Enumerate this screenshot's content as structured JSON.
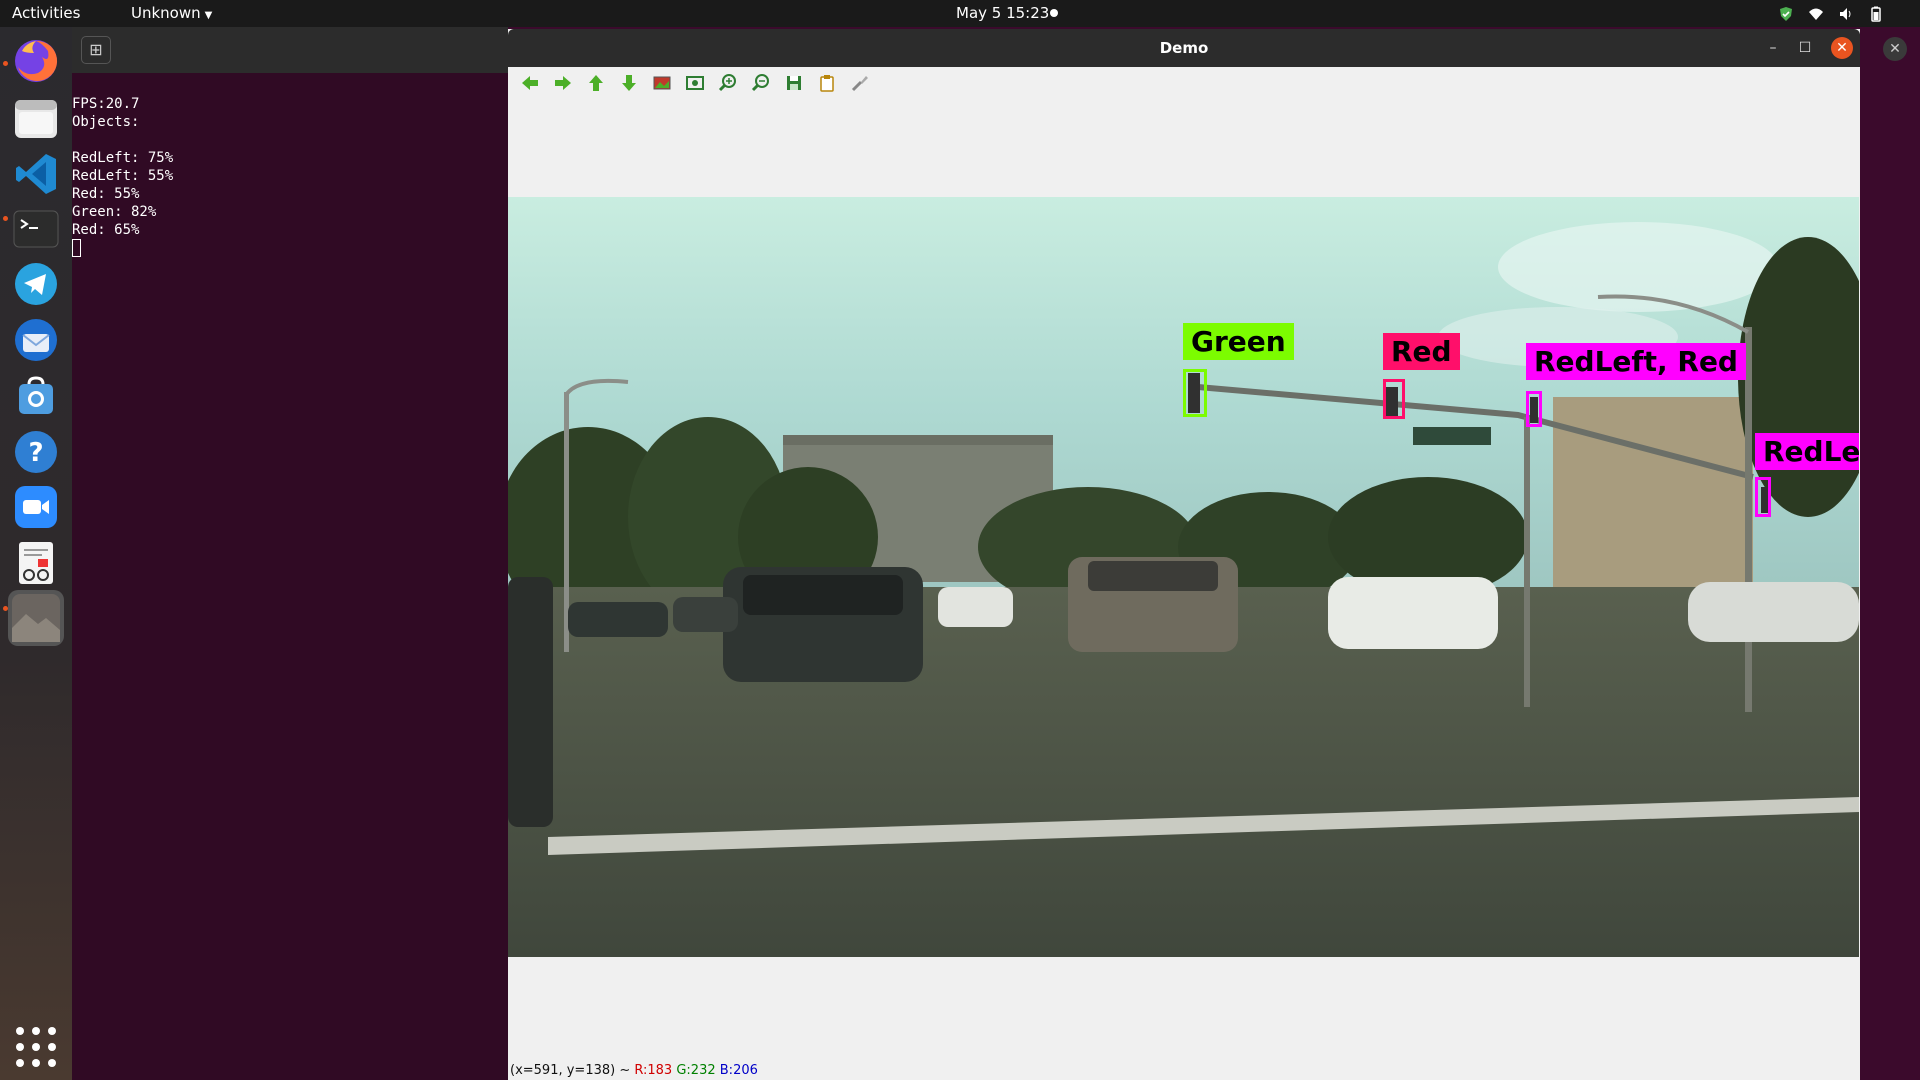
{
  "topbar": {
    "activities": "Activities",
    "app_menu": "Unknown",
    "clock": "May 5  15:23",
    "tray_icons": [
      "shield-icon",
      "wifi-icon",
      "volume-icon",
      "battery-icon"
    ]
  },
  "dock": {
    "apps": [
      "Firefox",
      "Files",
      "Visual Studio Code",
      "Terminal",
      "Telegram",
      "Thunderbird",
      "Software",
      "Help",
      "Zoom",
      "Document Viewer",
      "Image Viewer"
    ],
    "show_apps_icon": "grid-icon"
  },
  "terminal": {
    "new_tab_icon": "new-tab-icon",
    "lines": [
      "FPS:20.7",
      "Objects:",
      "",
      "RedLeft: 75%",
      "RedLeft: 55%",
      "Red: 55%",
      "Green: 82%",
      "Red: 65%"
    ]
  },
  "demo_window": {
    "title": "Demo",
    "toolbar": [
      "arrow-left-icon",
      "arrow-right-icon",
      "arrow-up-icon",
      "arrow-down-icon",
      "image-icon",
      "zoom-fit-icon",
      "zoom-in-icon",
      "zoom-out-icon",
      "save-icon",
      "copy-icon",
      "settings-icon"
    ],
    "status": {
      "coords": "(x=591, y=138) ~",
      "r": "R:183",
      "g": "G:232",
      "b": "B:206"
    },
    "detections": [
      {
        "label": "Green",
        "color": "#7cfc00"
      },
      {
        "label": "Red",
        "color": "#ff0f6a"
      },
      {
        "label": "RedLeft, Red",
        "color": "#ff00ff"
      },
      {
        "label": "RedLef",
        "color": "#ff00ff"
      }
    ]
  }
}
